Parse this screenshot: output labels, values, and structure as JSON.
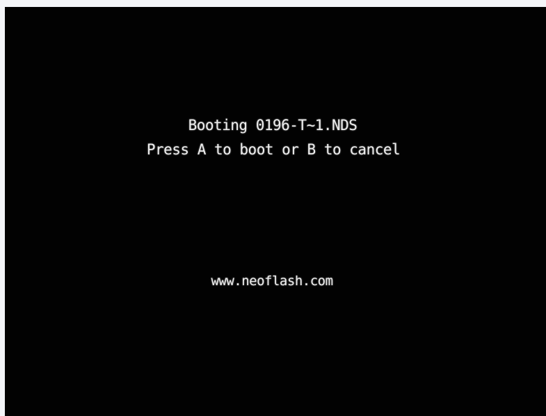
{
  "boot_screen": {
    "title_line": "Booting 0196-T~1.NDS",
    "prompt_line": "Press A to boot or B to cancel",
    "website": "www.neoflash.com"
  },
  "colors": {
    "background": "#020202",
    "text": "#eeeeee",
    "frame": "#f4f5f8"
  }
}
